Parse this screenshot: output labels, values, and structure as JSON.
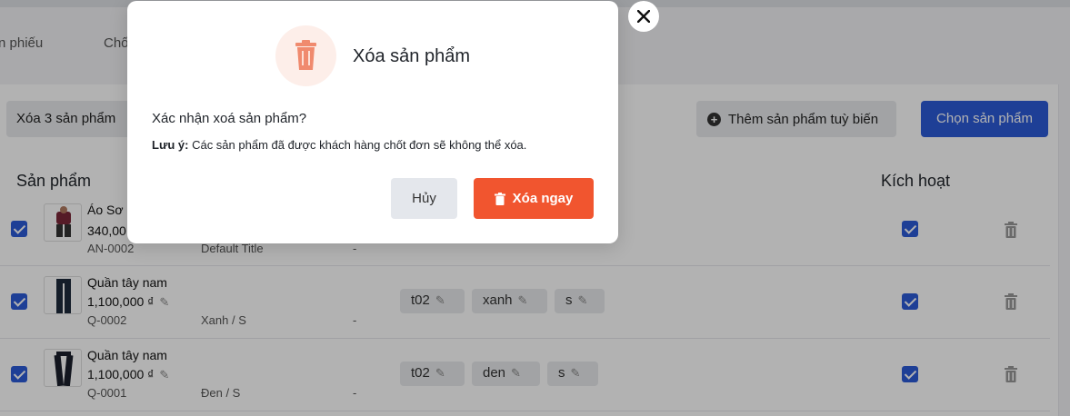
{
  "tabs": [
    "n phiếu",
    "Chố"
  ],
  "toolbar": {
    "delete_selected_label": "Xóa 3 sản phẩm",
    "add_custom_label": "Thêm sản phẩm tuỳ biến",
    "choose_product_label": "Chọn sản phẩm"
  },
  "table": {
    "headers": {
      "product": "Sản phẩm",
      "active": "Kích hoạt"
    },
    "rows": [
      {
        "name": "Áo Sơ r",
        "price": "340,00",
        "sku": "AN-0002",
        "variant": "Default Title",
        "dash": "-",
        "attrs": []
      },
      {
        "name": "Quần tây nam",
        "price": "1,100,000 ₫",
        "sku": "Q-0002",
        "variant": "Xanh / S",
        "dash": "-",
        "attrs": [
          "t02",
          "xanh",
          "s"
        ]
      },
      {
        "name": "Quần tây nam",
        "price": "1,100,000 ₫",
        "sku": "Q-0001",
        "variant": "Đen / S",
        "dash": "-",
        "attrs": [
          "t02",
          "den",
          "s"
        ]
      }
    ]
  },
  "modal": {
    "title": "Xóa sản phẩm",
    "question": "Xác nhận xoá sản phẩm?",
    "note_label": "Lưu ý:",
    "note_text": " Các sản phẩm đã được khách hàng chốt đơn sẽ không thể xóa.",
    "cancel_label": "Hủy",
    "confirm_label": "Xóa ngay"
  },
  "colors": {
    "primary": "#2c5bd7",
    "danger": "#f1552f",
    "danger_soft": "#fdeee9"
  },
  "icons": {
    "modal": "trash-icon",
    "close": "close-icon",
    "add": "plus-circle-icon",
    "edit": "pencil-icon"
  }
}
